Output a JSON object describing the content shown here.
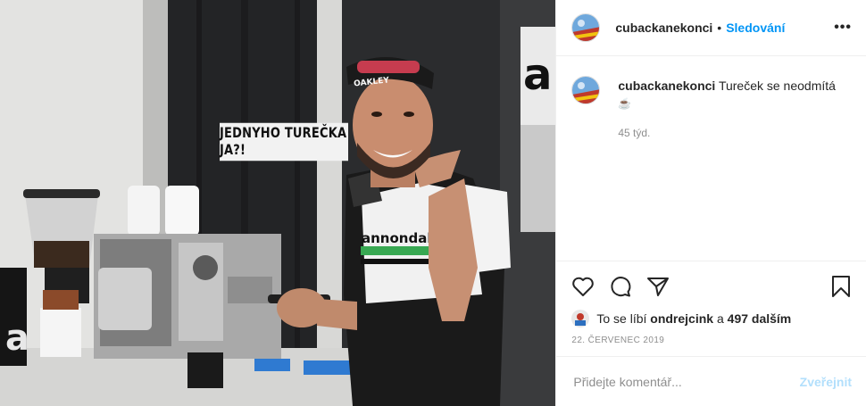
{
  "photo": {
    "overlay_text": "JEDNYHO TUREČKA JA?!",
    "cap_text": "OAKLEY",
    "jersey_text": "annondale"
  },
  "header": {
    "username": "cubackanekonci",
    "separator": "•",
    "follow_label": "Sledování",
    "more_label": "•••"
  },
  "comment": {
    "username": "cubackanekonci",
    "text": "Tureček se neodmítá",
    "emoji": "☕",
    "time": "45 týd."
  },
  "likes": {
    "prefix": "To se líbí",
    "user": "ondrejcink",
    "middle": "a",
    "count": "497 dalším"
  },
  "date": "22. ČERVENEC 2019",
  "add_comment": {
    "placeholder": "Přidejte komentář...",
    "publish_label": "Zveřejnit"
  }
}
